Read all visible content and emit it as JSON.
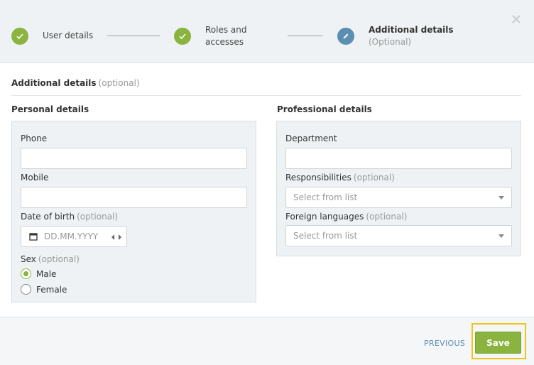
{
  "stepper": {
    "steps": [
      {
        "label": "User details",
        "state": "done"
      },
      {
        "label": "Roles and\naccesses",
        "label_line1": "Roles and",
        "label_line2": "accesses",
        "state": "done"
      },
      {
        "label": "Additional details",
        "sub": "(Optional)",
        "state": "active"
      }
    ]
  },
  "section": {
    "title": "Additional details",
    "optional": "(optional)"
  },
  "personal": {
    "title": "Personal details",
    "phone_label": "Phone",
    "mobile_label": "Mobile",
    "dob_label": "Date of birth",
    "dob_optional": "(optional)",
    "dob_placeholder": "DD.MM.YYYY",
    "sex_label": "Sex",
    "sex_optional": "(optional)",
    "sex_options": [
      "Male",
      "Female"
    ],
    "sex_selected": "Male"
  },
  "professional": {
    "title": "Professional details",
    "department_label": "Department",
    "responsibilities_label": "Responsibilities",
    "responsibilities_optional": "(optional)",
    "responsibilities_placeholder": "Select from list",
    "languages_label": "Foreign languages",
    "languages_optional": "(optional)",
    "languages_placeholder": "Select from list"
  },
  "footer": {
    "previous_label": "PREVIOUS",
    "save_label": "Save"
  },
  "colors": {
    "accent_green": "#8bb33f",
    "accent_blue": "#5b8fb2",
    "highlight": "#f0c419"
  }
}
